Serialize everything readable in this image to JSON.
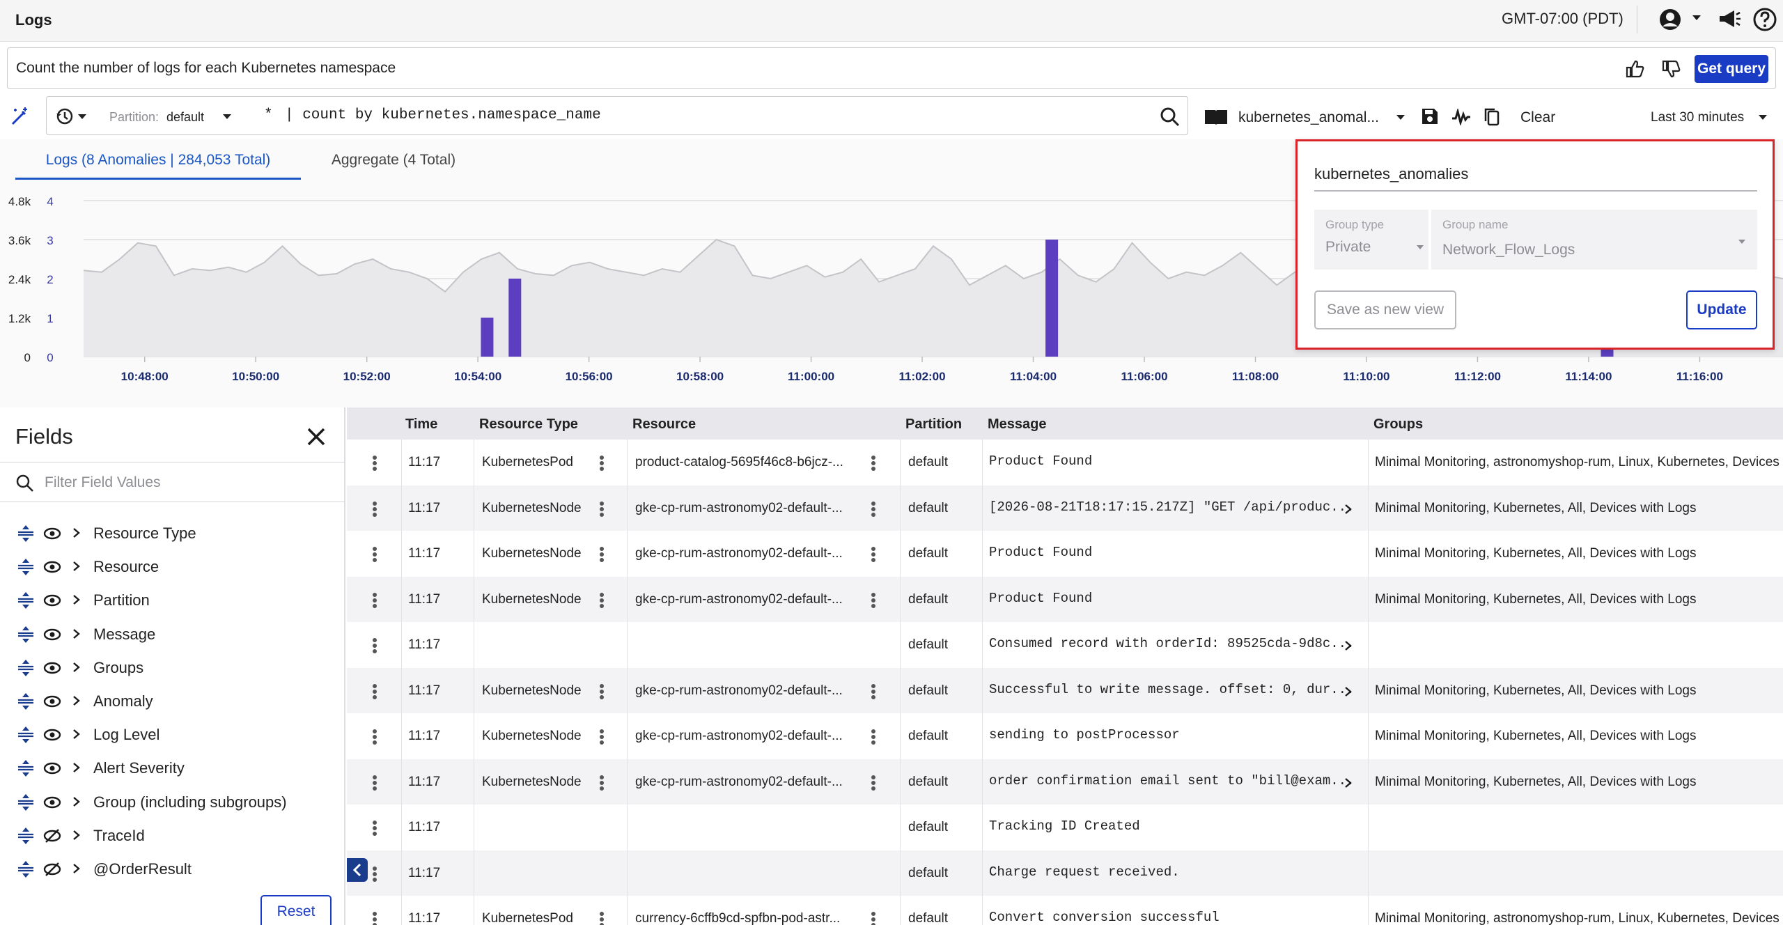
{
  "header": {
    "title": "Logs",
    "timezone": "GMT-07:00 (PDT)"
  },
  "nl_query": {
    "text": "Count the number of logs for each Kubernetes namespace",
    "get_query_label": "Get query"
  },
  "query_bar": {
    "partition_label": "Partition:",
    "partition_value": "default",
    "query_prefix": "*",
    "query_text": "| count by kubernetes.namespace_name",
    "view_name": "kubernetes_anomal...",
    "clear_label": "Clear",
    "time_range": "Last 30 minutes"
  },
  "tabs": [
    {
      "label": "Logs (8 Anomalies | 284,053 Total)"
    },
    {
      "label": "Aggregate (4 Total)"
    }
  ],
  "chart_data": {
    "type": "area",
    "x_ticks": [
      "10:48:00",
      "10:50:00",
      "10:52:00",
      "10:54:00",
      "10:56:00",
      "10:58:00",
      "11:00:00",
      "11:02:00",
      "11:04:00",
      "11:06:00",
      "11:08:00",
      "11:10:00",
      "11:12:00",
      "11:14:00",
      "11:16:00"
    ],
    "y_left_ticks": [
      "0",
      "1.2k",
      "2.4k",
      "3.6k",
      "4.8k"
    ],
    "y_right_ticks": [
      "0",
      "1",
      "2",
      "3",
      "4"
    ],
    "y_left_range": [
      0,
      4800
    ],
    "y_right_range": [
      0,
      4
    ],
    "series": [
      {
        "axis": "left",
        "values": [
          2650,
          2600,
          3000,
          3500,
          3400,
          2500,
          2700,
          2650,
          2750,
          2600,
          2900,
          3400,
          2850,
          2500,
          2550,
          2850,
          3000,
          2700,
          2600,
          2400,
          2000,
          2600,
          3000,
          3200,
          2700,
          2550,
          2500,
          2800,
          2900,
          2700,
          2600,
          2500,
          2700,
          2600,
          3100,
          3600,
          3400,
          2500,
          2400,
          2600,
          2800,
          2450,
          2600,
          3000,
          2300,
          2500,
          2700,
          3400,
          3000,
          2200,
          2500,
          2800,
          2400,
          2600,
          3000,
          2500,
          2300,
          2700,
          3500,
          2900,
          2400,
          2600,
          2500,
          2800,
          3200,
          2700,
          2200,
          2600,
          2700,
          2900,
          3000,
          2900,
          2800,
          3100,
          3200,
          2900,
          3100,
          2800,
          2600,
          2500,
          2600,
          3000,
          2700,
          2500,
          2450,
          2600,
          2800,
          2600,
          2750,
          2800,
          2700,
          2900,
          2600,
          2500,
          2400
        ]
      },
      {
        "axis": "right",
        "name": "Anomalies",
        "bars": [
          {
            "x": "10:54:10",
            "value": 1
          },
          {
            "x": "10:54:40",
            "value": 2
          },
          {
            "x": "11:04:20",
            "value": 3
          },
          {
            "x": "11:14:20",
            "value": 0.3
          }
        ]
      }
    ]
  },
  "popover": {
    "view_name": "kubernetes_anomalies",
    "group_type_label": "Group type",
    "group_type_value": "Private",
    "group_name_label": "Group name",
    "group_name_value": "Network_Flow_Logs",
    "save_new_label": "Save as new view",
    "update_label": "Update"
  },
  "fields_panel": {
    "title": "Fields",
    "filter_placeholder": "Filter Field Values",
    "items": [
      {
        "label": "Resource Type",
        "visible": true
      },
      {
        "label": "Resource",
        "visible": true
      },
      {
        "label": "Partition",
        "visible": true
      },
      {
        "label": "Message",
        "visible": true
      },
      {
        "label": "Groups",
        "visible": true
      },
      {
        "label": "Anomaly",
        "visible": true
      },
      {
        "label": "Log Level",
        "visible": true
      },
      {
        "label": "Alert Severity",
        "visible": true
      },
      {
        "label": "Group (including subgroups)",
        "visible": true
      },
      {
        "label": "TraceId",
        "visible": false
      },
      {
        "label": "@OrderResult",
        "visible": false
      }
    ],
    "reset_label": "Reset"
  },
  "table": {
    "columns": [
      "Time",
      "Resource Type",
      "Resource",
      "Partition",
      "Message",
      "Groups"
    ],
    "rows": [
      {
        "time": "11:17",
        "rtype": "KubernetesPod",
        "resource": "product-catalog-5695f46c8-b6jcz-...",
        "partition": "default",
        "message": "Product Found",
        "groups": "Minimal Monitoring, astronomyshop-rum, Linux, Kubernetes, Devices"
      },
      {
        "time": "11:17",
        "rtype": "KubernetesNode",
        "resource": "gke-cp-rum-astronomy02-default-...",
        "partition": "default",
        "message": "[2026-08-21T18:17:15.217Z] \"GET /api/produc...",
        "groups": "Minimal Monitoring, Kubernetes, All, Devices with Logs"
      },
      {
        "time": "11:17",
        "rtype": "KubernetesNode",
        "resource": "gke-cp-rum-astronomy02-default-...",
        "partition": "default",
        "message": "Product Found",
        "groups": "Minimal Monitoring, Kubernetes, All, Devices with Logs"
      },
      {
        "time": "11:17",
        "rtype": "KubernetesNode",
        "resource": "gke-cp-rum-astronomy02-default-...",
        "partition": "default",
        "message": "Product Found",
        "groups": "Minimal Monitoring, Kubernetes, All, Devices with Logs"
      },
      {
        "time": "11:17",
        "rtype": "",
        "resource": "",
        "partition": "default",
        "message": "Consumed record with orderId: 89525cda-9d8c...",
        "groups": ""
      },
      {
        "time": "11:17",
        "rtype": "KubernetesNode",
        "resource": "gke-cp-rum-astronomy02-default-...",
        "partition": "default",
        "message": "Successful to write message. offset: 0, dur...",
        "groups": "Minimal Monitoring, Kubernetes, All, Devices with Logs"
      },
      {
        "time": "11:17",
        "rtype": "KubernetesNode",
        "resource": "gke-cp-rum-astronomy02-default-...",
        "partition": "default",
        "message": "sending to postProcessor",
        "groups": "Minimal Monitoring, Kubernetes, All, Devices with Logs"
      },
      {
        "time": "11:17",
        "rtype": "KubernetesNode",
        "resource": "gke-cp-rum-astronomy02-default-...",
        "partition": "default",
        "message": "order confirmation email sent to \"bill@exam...",
        "groups": "Minimal Monitoring, Kubernetes, All, Devices with Logs"
      },
      {
        "time": "11:17",
        "rtype": "",
        "resource": "",
        "partition": "default",
        "message": "Tracking ID Created",
        "groups": ""
      },
      {
        "time": "11:17",
        "rtype": "",
        "resource": "",
        "partition": "default",
        "message": "Charge request received.",
        "groups": ""
      },
      {
        "time": "11:17",
        "rtype": "KubernetesPod",
        "resource": "currency-6cffb9cd-spfbn-pod-astr...",
        "partition": "default",
        "message": "Convert conversion successful",
        "groups": "Minimal Monitoring, astronomyshop-rum, Linux, Kubernetes, Devices"
      }
    ]
  },
  "colors": {
    "accent": "#1a3cc4",
    "anomaly_bar": "#5b3fc0",
    "highlight_border": "#d9232a"
  }
}
